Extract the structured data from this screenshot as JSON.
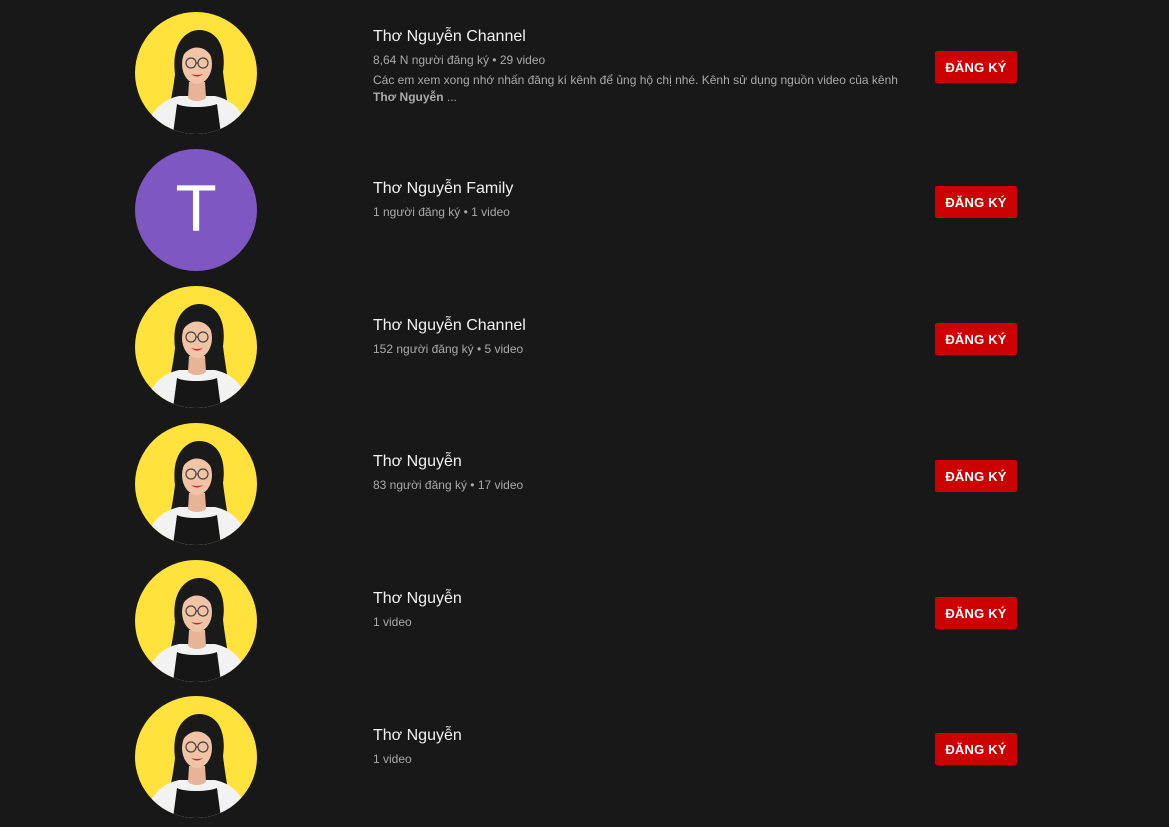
{
  "channels": [
    {
      "name": "Thơ Nguyễn Channel",
      "meta": "8,64 N người đăng ký • 29 video",
      "description_plain": "Các em xem xong nhớ nhấn đăng kí kênh để ủng hộ chị nhé. Kênh sử dụng nguồn video của kênh ",
      "description_bold": "Thơ Nguyễn",
      "description_tail": " ...",
      "avatar": "photo",
      "subscribe_label": "ĐĂNG KÝ"
    },
    {
      "name": "Thơ Nguyễn Family",
      "meta": "1 người đăng ký • 1 video",
      "avatar": "letter",
      "avatar_letter": "T",
      "avatar_color": "#7e57c2",
      "subscribe_label": "ĐĂNG KÝ"
    },
    {
      "name": "Thơ Nguyễn Channel",
      "meta": "152 người đăng ký • 5 video",
      "avatar": "photo",
      "subscribe_label": "ĐĂNG KÝ"
    },
    {
      "name": "Thơ Nguyễn",
      "meta": "83 người đăng ký • 17 video",
      "avatar": "photo",
      "subscribe_label": "ĐĂNG KÝ"
    },
    {
      "name": "Thơ Nguyễn",
      "meta": "1 video",
      "avatar": "photo",
      "subscribe_label": "ĐĂNG KÝ"
    },
    {
      "name": "Thơ Nguyễn",
      "meta": "1 video",
      "avatar": "photo",
      "subscribe_label": "ĐĂNG KÝ"
    }
  ],
  "colors": {
    "background": "#181818",
    "subscribe_button": "#cc0000",
    "avatar_photo_background": "#ffe23b",
    "title_text": "#f1f1f1",
    "meta_text": "#aaaaaa"
  }
}
